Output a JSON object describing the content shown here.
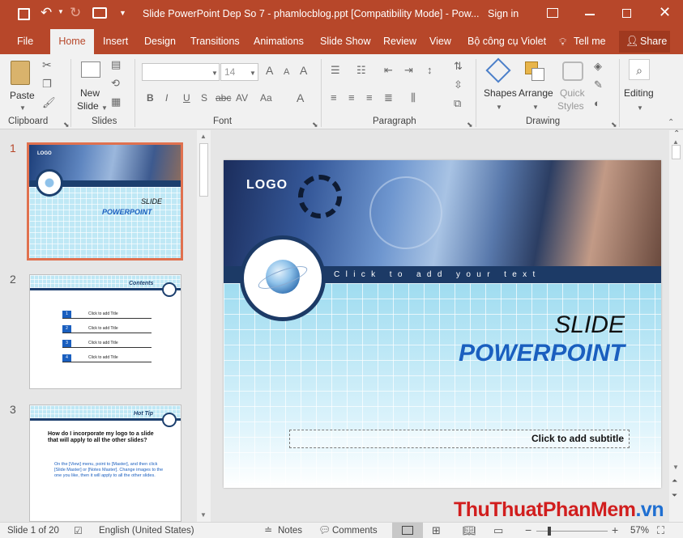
{
  "window": {
    "title": "Slide PowerPoint Dep So 7 - phamlocblog.ppt [Compatibility Mode]  -  Pow...",
    "sign_in": "Sign in"
  },
  "tabs": [
    "File",
    "Home",
    "Insert",
    "Design",
    "Transitions",
    "Animations",
    "Slide Show",
    "Review",
    "View",
    "Bộ công cụ Violet"
  ],
  "tell_me": "Tell me",
  "share": "Share",
  "ribbon": {
    "paste": "Paste",
    "new_slide_1": "New",
    "new_slide_2": "Slide",
    "font_size": "14",
    "shapes": "Shapes",
    "arrange": "Arrange",
    "quick_1": "Quick",
    "quick_2": "Styles",
    "editing": "Editing",
    "groups": {
      "clipboard": "Clipboard",
      "slides": "Slides",
      "font": "Font",
      "paragraph": "Paragraph",
      "drawing": "Drawing"
    }
  },
  "thumbs": [
    {
      "num": "1",
      "logo": "LOGO",
      "t1": "SLIDE",
      "t2": "POWERPOINT"
    },
    {
      "num": "2",
      "header": "Contents",
      "items": [
        "Click to add Title",
        "Click to add Title",
        "Click to add Title",
        "Click to add Title"
      ],
      "nums": [
        "1",
        "2",
        "3",
        "4"
      ]
    },
    {
      "num": "3",
      "header": "Hot Tip",
      "q": "How do I incorporate my logo to a slide that will apply to all the other slides?",
      "a": "On the [View] menu, point to [Master], and then click [Slide Master] or [Notes Master]. Change images to the one you like, then it will apply to all the other slides."
    }
  ],
  "slide": {
    "logo": "LOGO",
    "band": "C l i c k   t o   a d d   y o u r   t e x t",
    "title1": "SLIDE",
    "title2": "POWERPOINT",
    "subtitle": "Click to add subtitle"
  },
  "status": {
    "slide_of": "Slide 1 of 20",
    "language": "English (United States)",
    "notes": "Notes",
    "comments": "Comments",
    "zoom": "57%"
  },
  "watermark": {
    "p1": "Thu",
    "p2": "Thuat",
    "p3": "PhanMem",
    ".vn": ".vn"
  },
  "colors": {
    "accent": "#b7472a",
    "selected_thumb": "#e0714f",
    "slide_blue": "#1a5fbf"
  }
}
